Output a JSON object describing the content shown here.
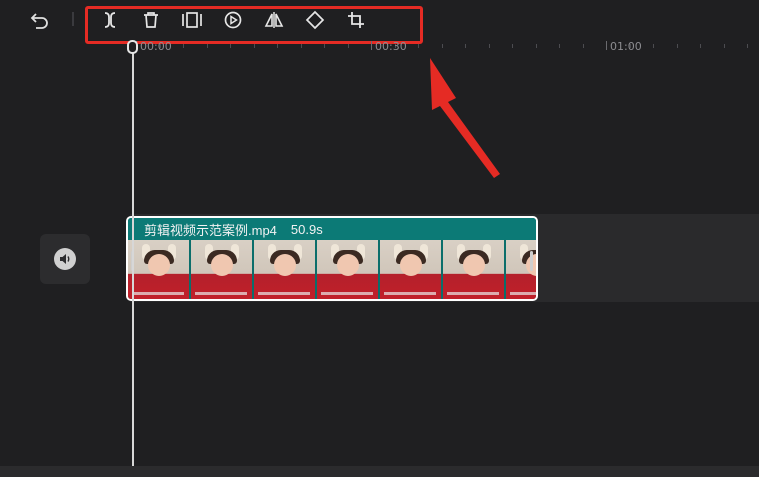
{
  "toolbar": {
    "undo_icon": "undo-icon",
    "tools": [
      {
        "name": "split",
        "icon": "split-icon"
      },
      {
        "name": "delete",
        "icon": "trash-icon"
      },
      {
        "name": "freeze-frame",
        "icon": "freeze-frame-icon"
      },
      {
        "name": "speed",
        "icon": "play-speed-icon"
      },
      {
        "name": "mirror",
        "icon": "mirror-icon"
      },
      {
        "name": "rotate",
        "icon": "rotate-icon"
      },
      {
        "name": "crop",
        "icon": "crop-icon"
      }
    ]
  },
  "ruler": {
    "labels": [
      "00:00",
      "00:30",
      "01:00"
    ]
  },
  "clip": {
    "filename": "剪辑视频示范案例.mp4",
    "duration": "50.9s"
  },
  "audio_track": {
    "icon": "speaker-icon"
  },
  "colors": {
    "highlight": "#e52b24",
    "clip_header": "#0c7a76",
    "background": "#1f1f21"
  }
}
